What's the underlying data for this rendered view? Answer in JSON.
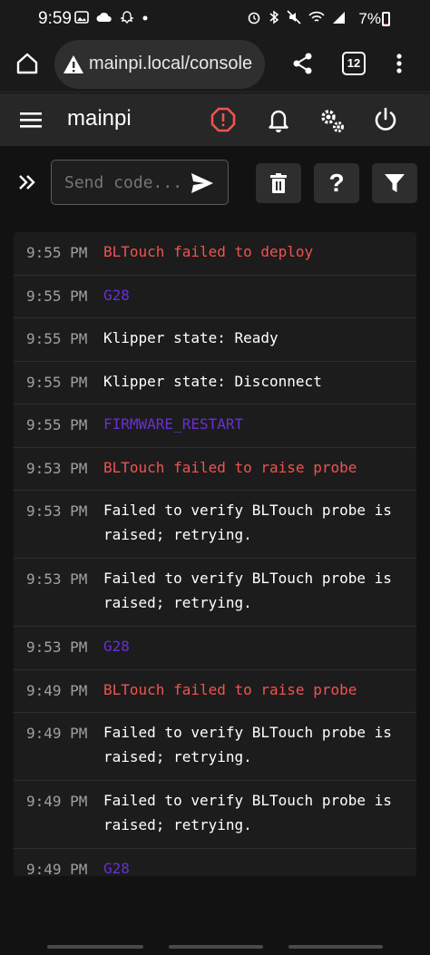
{
  "status": {
    "time": "9:59",
    "battery": "7%",
    "battery_level": 0.07
  },
  "browser": {
    "url": "mainpi.local/console",
    "tab_count": "12"
  },
  "app": {
    "title": "mainpi"
  },
  "command": {
    "placeholder": "Send code...",
    "help_label": "?"
  },
  "console": {
    "entries": [
      {
        "time": "9:55 PM",
        "message": "BLTouch failed to deploy",
        "color": "red"
      },
      {
        "time": "9:55 PM",
        "message": "G28",
        "color": "purple"
      },
      {
        "time": "9:55 PM",
        "message": "Klipper state: Ready",
        "color": "white"
      },
      {
        "time": "9:55 PM",
        "message": "Klipper state: Disconnect",
        "color": "white"
      },
      {
        "time": "9:55 PM",
        "message": "FIRMWARE_RESTART",
        "color": "purple"
      },
      {
        "time": "9:53 PM",
        "message": "BLTouch failed to raise probe",
        "color": "red"
      },
      {
        "time": "9:53 PM",
        "message": "Failed to verify BLTouch probe is raised; retrying.",
        "color": "white"
      },
      {
        "time": "9:53 PM",
        "message": "Failed to verify BLTouch probe is raised; retrying.",
        "color": "white"
      },
      {
        "time": "9:53 PM",
        "message": "G28",
        "color": "purple"
      },
      {
        "time": "9:49 PM",
        "message": "BLTouch failed to raise probe",
        "color": "red"
      },
      {
        "time": "9:49 PM",
        "message": "Failed to verify BLTouch probe is raised; retrying.",
        "color": "white"
      },
      {
        "time": "9:49 PM",
        "message": "Failed to verify BLTouch probe is raised; retrying.",
        "color": "white"
      },
      {
        "time": "9:49 PM",
        "message": "G28",
        "color": "purple"
      }
    ]
  },
  "colors": {
    "error": "#ef5350",
    "command": "#6a2fd6",
    "info": "#ffffff",
    "warning_icon": "#ef5350"
  },
  "icons": {
    "home": "home-icon",
    "warning": "warning-triangle-icon",
    "share": "share-icon",
    "tabs": "tabs-icon",
    "overflow": "more-vert-icon",
    "menu": "hamburger-menu-icon",
    "alert": "alert-octagon-icon",
    "notifications": "bell-icon",
    "settings": "gears-icon",
    "power": "power-icon",
    "expand": "double-chevron-right-icon",
    "send": "send-icon",
    "clear": "trash-icon",
    "help": "help-icon",
    "filter": "filter-icon"
  }
}
